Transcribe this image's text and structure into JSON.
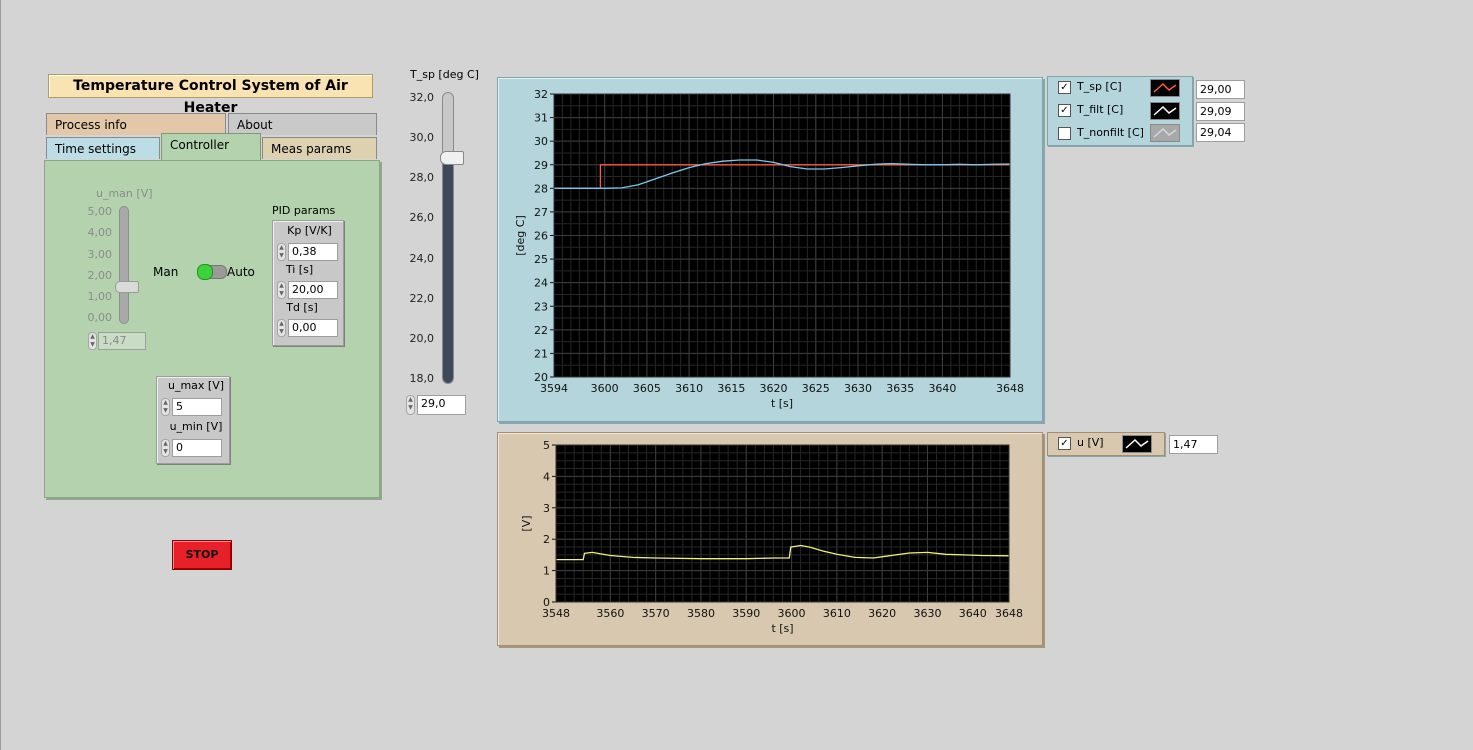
{
  "window": {
    "title": "Temperature Control System of Air Heater"
  },
  "tabs": {
    "process_info": "Process info",
    "about": "About",
    "time_settings": "Time settings",
    "controller": "Controller",
    "meas_params": "Meas params"
  },
  "controller": {
    "u_man_label": "u_man [V]",
    "u_man_scale": [
      "5,00",
      "4,00",
      "3,00",
      "2,00",
      "1,00",
      "0,00"
    ],
    "u_man_value": "1,47",
    "man_label": "Man",
    "auto_label": "Auto",
    "mode_state": "Auto",
    "pid_label": "PID params",
    "kp_label": "Kp [V/K]",
    "kp_value": "0,38",
    "ti_label": "Ti [s]",
    "ti_value": "20,00",
    "td_label": "Td [s]",
    "td_value": "0,00",
    "umax_label": "u_max [V]",
    "umax_value": "5",
    "umin_label": "u_min [V]",
    "umin_value": "0"
  },
  "stop_label": "STOP",
  "setpoint_slider": {
    "label": "T_sp [deg C]",
    "scale": [
      "32,0",
      "30,0",
      "28,0",
      "26,0",
      "24,0",
      "22,0",
      "20,0",
      "18,0"
    ],
    "value": "29,0",
    "level": 29.0,
    "min": 18.0,
    "max": 32.0
  },
  "legend_top": [
    {
      "name": "T_sp [C]",
      "checked": true,
      "value": "29,00"
    },
    {
      "name": "T_filt [C]",
      "checked": true,
      "value": "29,09"
    },
    {
      "name": "T_nonfilt [C]",
      "checked": false,
      "value": "29,04"
    }
  ],
  "legend_bottom": [
    {
      "name": "u [V]",
      "checked": true,
      "value": "1,47"
    }
  ],
  "colors": {
    "tsp_line": "#ff5a3c",
    "tfilt_line": "#7ec8f0",
    "u_line": "#f0f07a",
    "plot_bg": "#000000",
    "grid": "#3c3c3c"
  },
  "chart_data": [
    {
      "type": "line",
      "xlabel": "t [s]",
      "ylabel": "[deg C]",
      "xlim": [
        3594,
        3648
      ],
      "ylim": [
        20,
        32
      ],
      "xticks": [
        "3594",
        "3600",
        "3605",
        "3610",
        "3615",
        "3620",
        "3625",
        "3630",
        "3635",
        "3640",
        "3648"
      ],
      "xtick_values": [
        3594,
        3600,
        3605,
        3610,
        3615,
        3620,
        3625,
        3630,
        3635,
        3640,
        3648
      ],
      "yticks": [
        "20",
        "21",
        "22",
        "23",
        "24",
        "25",
        "26",
        "27",
        "28",
        "29",
        "30",
        "31",
        "32"
      ],
      "grid": true,
      "series": [
        {
          "name": "T_sp [C]",
          "color": "#ff5a3c",
          "x": [
            3594,
            3599.5,
            3599.5,
            3648
          ],
          "y": [
            28.0,
            28.0,
            29.0,
            29.0
          ]
        },
        {
          "name": "T_filt [C]",
          "color": "#7ec8f0",
          "x": [
            3594,
            3598,
            3600,
            3602,
            3604,
            3606,
            3608,
            3610,
            3612,
            3614,
            3616,
            3618,
            3620,
            3622,
            3624,
            3626,
            3628,
            3630,
            3632,
            3634,
            3636,
            3638,
            3640,
            3642,
            3644,
            3646,
            3648
          ],
          "y": [
            28.0,
            28.0,
            28.0,
            28.02,
            28.15,
            28.4,
            28.65,
            28.88,
            29.05,
            29.15,
            29.2,
            29.2,
            29.1,
            28.92,
            28.82,
            28.82,
            28.88,
            28.95,
            29.02,
            29.05,
            29.02,
            29.0,
            29.0,
            29.02,
            29.0,
            29.02,
            29.03
          ]
        }
      ]
    },
    {
      "type": "line",
      "xlabel": "t [s]",
      "ylabel": "[V]",
      "xlim": [
        3548,
        3648
      ],
      "ylim": [
        0,
        5
      ],
      "xticks": [
        "3548",
        "3560",
        "3570",
        "3580",
        "3590",
        "3600",
        "3610",
        "3620",
        "3630",
        "3640",
        "3648"
      ],
      "xtick_values": [
        3548,
        3560,
        3570,
        3580,
        3590,
        3600,
        3610,
        3620,
        3630,
        3640,
        3648
      ],
      "yticks": [
        "0",
        "1",
        "2",
        "3",
        "4",
        "5"
      ],
      "grid": true,
      "series": [
        {
          "name": "u [V]",
          "color": "#f0f07a",
          "x": [
            3548,
            3554,
            3554.3,
            3556,
            3560,
            3565,
            3570,
            3580,
            3590,
            3596,
            3599.5,
            3599.8,
            3602,
            3604,
            3607,
            3610,
            3614,
            3618,
            3622,
            3626,
            3630,
            3634,
            3638,
            3642,
            3648
          ],
          "y": [
            1.35,
            1.35,
            1.55,
            1.58,
            1.48,
            1.42,
            1.4,
            1.38,
            1.38,
            1.4,
            1.4,
            1.75,
            1.8,
            1.75,
            1.62,
            1.52,
            1.42,
            1.4,
            1.48,
            1.56,
            1.58,
            1.52,
            1.5,
            1.48,
            1.47
          ]
        }
      ]
    }
  ]
}
